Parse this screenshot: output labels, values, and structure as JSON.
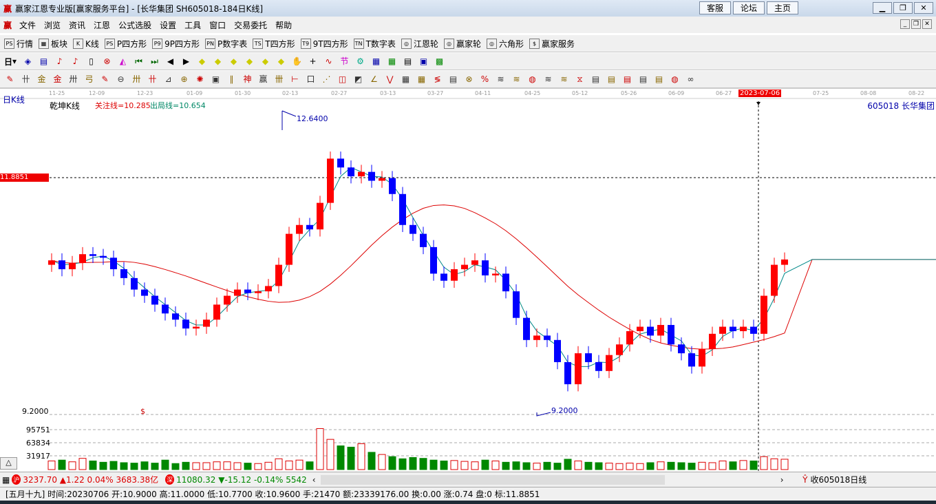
{
  "window": {
    "title": "赢家江恩专业版[赢家服务平台] - [长华集团  SH605018-184日K线]",
    "logo": "赢",
    "top_buttons": [
      "客服",
      "论坛",
      "主页"
    ]
  },
  "menu": [
    "文件",
    "浏览",
    "资讯",
    "江恩",
    "公式选股",
    "设置",
    "工具",
    "窗口",
    "交易委托",
    "帮助"
  ],
  "toolbar1": [
    {
      "icon": "PS",
      "label": "行情"
    },
    {
      "icon": "▦",
      "label": "板块"
    },
    {
      "icon": "K",
      "label": "K线"
    },
    {
      "icon": "PS",
      "label": "P四方形"
    },
    {
      "icon": "P9",
      "label": "9P四方形"
    },
    {
      "icon": "PN",
      "label": "P数字表"
    },
    {
      "icon": "TS",
      "label": "T四方形"
    },
    {
      "icon": "T9",
      "label": "9T四方形"
    },
    {
      "icon": "TN",
      "label": "T数字表"
    },
    {
      "icon": "◎",
      "label": "江恩轮"
    },
    {
      "icon": "◎",
      "label": "赢家轮"
    },
    {
      "icon": "◎",
      "label": "六角形"
    },
    {
      "icon": "$",
      "label": "赢家服务"
    }
  ],
  "toolbar2": {
    "period": "日"
  },
  "chart": {
    "period_label": "日K线",
    "indicator_name": "乾坤K线",
    "focus_line": "关注线=10.285",
    "exit_line": "出局线=10.654",
    "stock": "605018  长华集团",
    "high_label": "12.6400",
    "low_label": "9.2000",
    "crosshair_price": "11.8851",
    "price_floor_label": "9.2000",
    "dollar_mark": "$",
    "crosshair_date": "2023-07-06",
    "dates": [
      "11-25",
      "12-09",
      "12-23",
      "01-09",
      "01-30",
      "02-13",
      "02-27",
      "03-13",
      "03-27",
      "04-11",
      "04-25",
      "05-12",
      "05-26",
      "06-09",
      "06-27",
      "07-25",
      "08-08",
      "08-22"
    ],
    "volume_ticks": [
      "95751",
      "63834",
      "31917"
    ]
  },
  "chart_data": {
    "type": "candlestick",
    "ylim": [
      9.2,
      12.64
    ],
    "closes": [
      10.95,
      10.85,
      10.92,
      11.02,
      11.0,
      10.98,
      10.85,
      10.75,
      10.62,
      10.55,
      10.45,
      10.35,
      10.28,
      10.18,
      10.2,
      10.28,
      10.45,
      10.55,
      10.62,
      10.58,
      10.6,
      10.66,
      10.9,
      11.25,
      11.35,
      11.3,
      11.6,
      12.1,
      12.0,
      11.9,
      11.95,
      11.85,
      11.88,
      11.7,
      11.35,
      11.25,
      11.1,
      10.8,
      10.72,
      10.85,
      10.9,
      10.95,
      10.78,
      10.8,
      10.6,
      10.3,
      10.05,
      10.1,
      10.05,
      9.8,
      9.55,
      9.9,
      9.8,
      9.7,
      9.88,
      10.0,
      10.15,
      10.2,
      10.1,
      10.22,
      10.0,
      9.9,
      9.75,
      9.95,
      10.12,
      10.2,
      10.15,
      10.2,
      10.12,
      10.55,
      10.9,
      10.96
    ],
    "volumes": [
      20000,
      22000,
      18000,
      26000,
      20000,
      17000,
      19000,
      16000,
      15000,
      18000,
      15000,
      22000,
      14000,
      17000,
      16000,
      16000,
      18000,
      18000,
      16000,
      15000,
      14000,
      17000,
      25000,
      20000,
      22000,
      18000,
      95000,
      70000,
      55000,
      52000,
      60000,
      40000,
      35000,
      30000,
      25000,
      28000,
      26000,
      22000,
      20000,
      21000,
      19000,
      18000,
      22000,
      20000,
      17000,
      18000,
      16000,
      15000,
      17000,
      15000,
      24000,
      20000,
      17000,
      16000,
      15000,
      14000,
      15000,
      14000,
      16000,
      18000,
      17000,
      16000,
      15000,
      17000,
      16000,
      20000,
      18000,
      21000,
      20000,
      30000,
      25000,
      24000
    ]
  },
  "status": {
    "sh_icon": "沪",
    "sh": "3237.70 ▲1.22 0.04% 3683.38亿",
    "sz_icon": "深",
    "sz": "11080.32 ▼-15.12 -0.14% 5542.38",
    "receive": "收605018日线"
  },
  "info": "[五月十九] 时间:20230706 开:10.9000 高:11.0000 低:10.7700 收:10.9600 手:21470 额:23339176.00 换:0.00 涨:0.74 盘:0 标:11.8851"
}
